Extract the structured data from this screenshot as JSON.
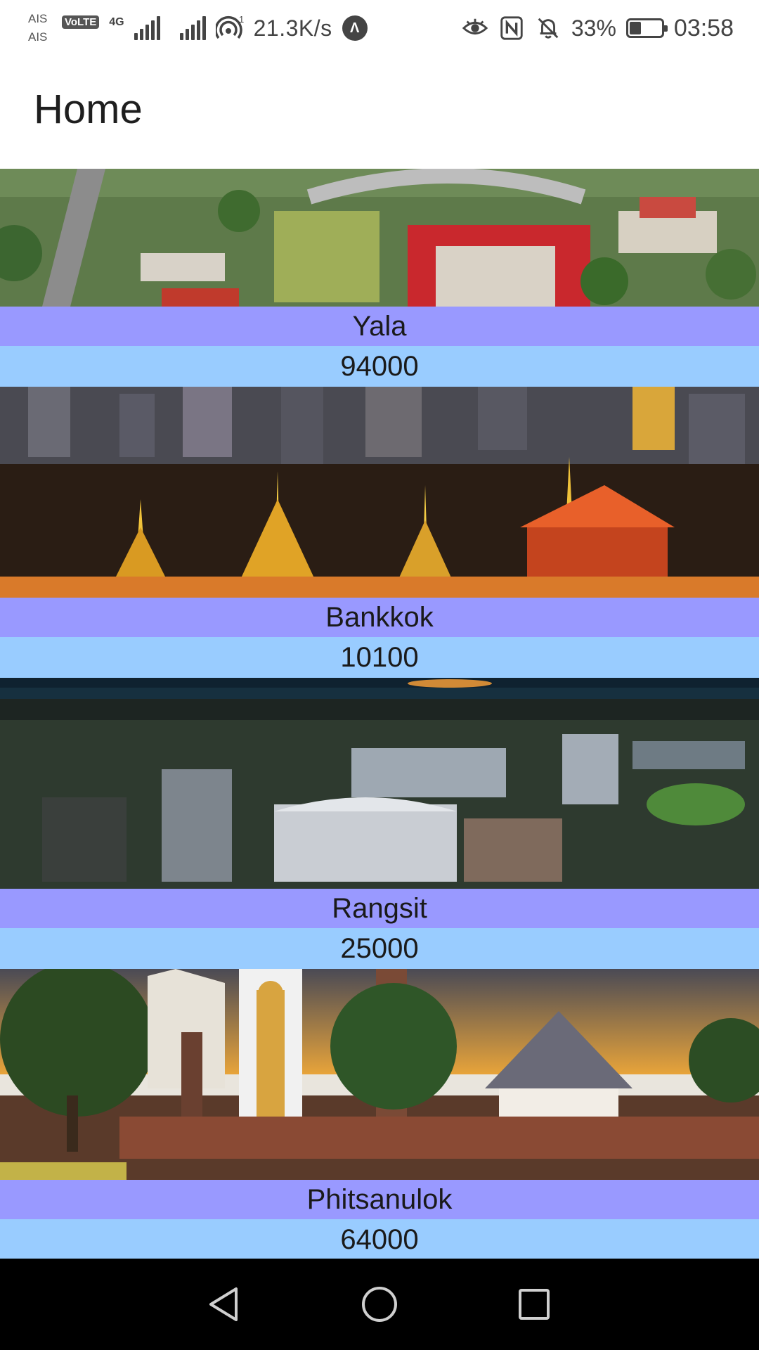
{
  "status_bar": {
    "carrier_top": "AIS",
    "carrier_bottom": "AIS",
    "volte": "VoLTE",
    "network": "4G",
    "hotspot_count": "1",
    "speed": "21.3K/s",
    "app_badge": "Λ",
    "battery_percent": "33%",
    "battery_level": 0.33,
    "time": "03:58",
    "icons": [
      "eye-icon",
      "nfc-icon",
      "bell-off-icon",
      "battery-icon"
    ]
  },
  "app_bar": {
    "title": "Home"
  },
  "cities": [
    {
      "name": "Yala",
      "zip": "94000"
    },
    {
      "name": "Bankkok",
      "zip": "10100"
    },
    {
      "name": "Rangsit",
      "zip": "25000"
    },
    {
      "name": "Phitsanulok",
      "zip": "64000"
    }
  ],
  "nav_bar": {
    "icons": [
      "back-icon",
      "home-icon",
      "recents-icon"
    ]
  },
  "colors": {
    "title_band": "#9999ff",
    "zip_band": "#99ccff",
    "nav_bg": "#000000"
  }
}
